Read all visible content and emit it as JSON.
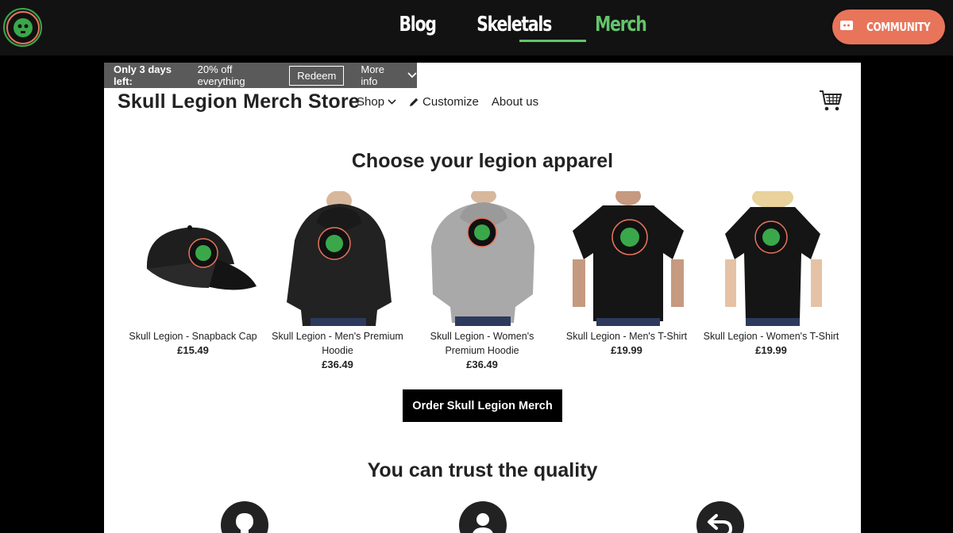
{
  "site": {
    "nav": [
      {
        "label": "Blog"
      },
      {
        "label": "Skeletals"
      },
      {
        "label": "Merch",
        "active": true
      }
    ],
    "community_label": "COMMUNITY",
    "logo_icon": "skull-legion-logo",
    "accent": "#63c46a",
    "community_color": "#e8745a"
  },
  "promo": {
    "bold": "Only 3 days left:",
    "text": "20% off everything",
    "redeem": "Redeem",
    "more_info": "More info"
  },
  "store": {
    "title": "Skull Legion Merch Store",
    "nav": {
      "shop": "Shop",
      "customize": "Customize",
      "about": "About us"
    }
  },
  "main": {
    "heading": "Choose your legion apparel",
    "products": [
      {
        "name": "Skull Legion - Snapback Cap",
        "price": "£15.49"
      },
      {
        "name": "Skull Legion - Men's Premium Hoodie",
        "price": "£36.49"
      },
      {
        "name": "Skull Legion - Women's Premium Hoodie",
        "price": "£36.49"
      },
      {
        "name": "Skull Legion - Men's T-Shirt",
        "price": "£19.99"
      },
      {
        "name": "Skull Legion - Women's T-Shirt",
        "price": "£19.99"
      }
    ],
    "order_button": "Order Skull Legion Merch",
    "quality_heading": "You can trust the quality",
    "feature_icons": [
      "lightbulb-icon",
      "user-icon",
      "return-icon"
    ]
  }
}
